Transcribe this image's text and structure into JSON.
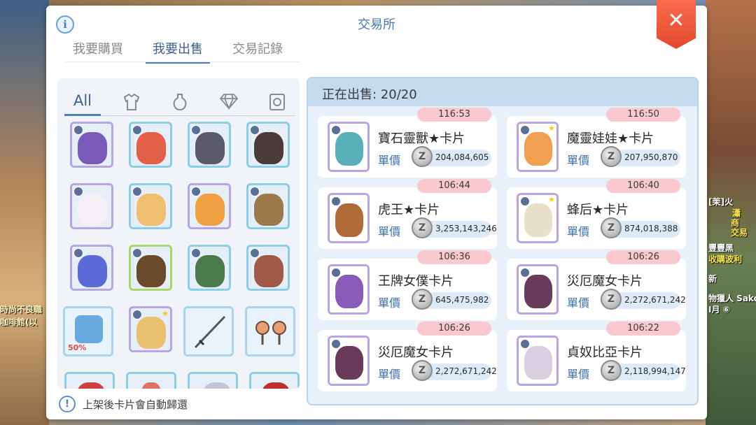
{
  "background": {
    "left_texts": [
      "時尚不良職",
      "咖啡館(以"
    ],
    "right_texts": [
      "[茉]火",
      "瀟",
      "商",
      "交易",
      "豐豐黑",
      "收購波利",
      "新",
      "物獵人 Sako",
      "I月 ⑥"
    ]
  },
  "dialog": {
    "title": "交易所",
    "info_icon": "info-icon",
    "close_icon": "close-icon",
    "tabs": [
      {
        "label": "我要購買",
        "active": false
      },
      {
        "label": "我要出售",
        "active": true
      },
      {
        "label": "交易記錄",
        "active": false
      }
    ]
  },
  "bag": {
    "categories": [
      {
        "label": "All",
        "icon": "all",
        "active": true
      },
      {
        "label": "",
        "icon": "armor-icon",
        "active": false
      },
      {
        "label": "",
        "icon": "potion-icon",
        "active": false
      },
      {
        "label": "",
        "icon": "gem-icon",
        "active": false
      },
      {
        "label": "",
        "icon": "card-icon",
        "active": false
      }
    ],
    "equip_slot_percent": "50%",
    "hint": "上架後卡片會自動歸還"
  },
  "sale": {
    "header": "正在出售: 20/20",
    "unit_label": "單價",
    "currency_symbol": "Z",
    "items": [
      {
        "timer": "116:53",
        "name": "寶石靈獸★卡片",
        "price": "204,084,605"
      },
      {
        "timer": "116:50",
        "name": "魔靈娃娃★卡片",
        "price": "207,950,870"
      },
      {
        "timer": "106:44",
        "name": "虎王★卡片",
        "price": "3,253,143,246"
      },
      {
        "timer": "106:40",
        "name": "蜂后★卡片",
        "price": "874,018,388"
      },
      {
        "timer": "106:36",
        "name": "王牌女僕卡片",
        "price": "645,475,982"
      },
      {
        "timer": "106:26",
        "name": "災厄魔女卡片",
        "price": "2,272,671,242"
      },
      {
        "timer": "106:26",
        "name": "災厄魔女卡片",
        "price": "2,272,671,242"
      },
      {
        "timer": "106:22",
        "name": "貞奴比亞卡片",
        "price": "2,118,994,147"
      }
    ]
  },
  "colors": {
    "accent": "#4f7fbf",
    "timer_bg": "#f9c9cf",
    "close": "#e14a2c"
  }
}
